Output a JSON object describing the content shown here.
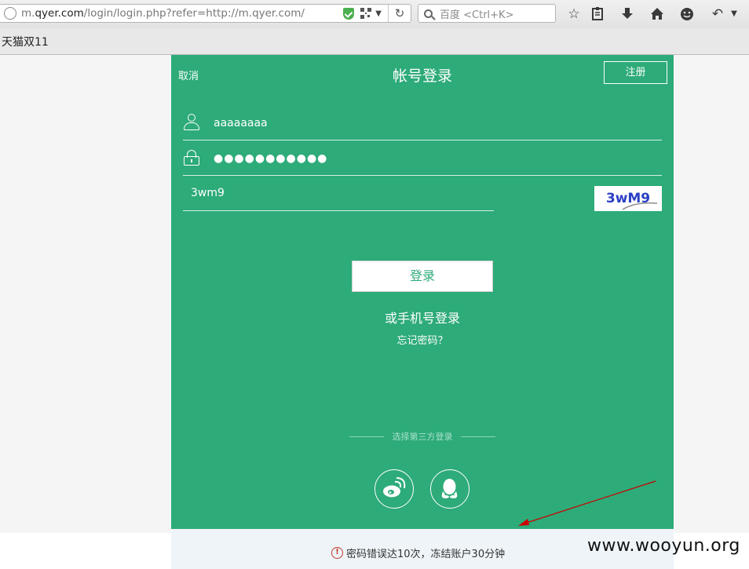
{
  "browser": {
    "url_prefix": "m.",
    "url_host": "qyer.com",
    "url_rest": "/login/login.php?refer=http://m.qyer.com/",
    "search_placeholder": "百度 <Ctrl+K>",
    "bookmark": "天猫双11"
  },
  "login": {
    "cancel_label": "取消",
    "title": "帐号登录",
    "register_label": "注册",
    "username": "aaaaaaaa",
    "password_mask": "●●●●●●●●●●●",
    "captcha_input": "3wm9",
    "captcha_image_text": "3wM9",
    "login_button": "登录",
    "phone_login": "或手机号登录",
    "forgot_password": "忘记密码？",
    "third_party_label": "选择第三方登录"
  },
  "social": [
    "weibo-icon",
    "qq-icon"
  ],
  "alert": {
    "message": "密码错误达10次，冻结账户30分钟"
  },
  "watermark": "www.wooyun.org",
  "colors": {
    "brand_green": "#2dab79",
    "error_red": "#c0392b",
    "annotation_arrow": "#cc0000"
  }
}
